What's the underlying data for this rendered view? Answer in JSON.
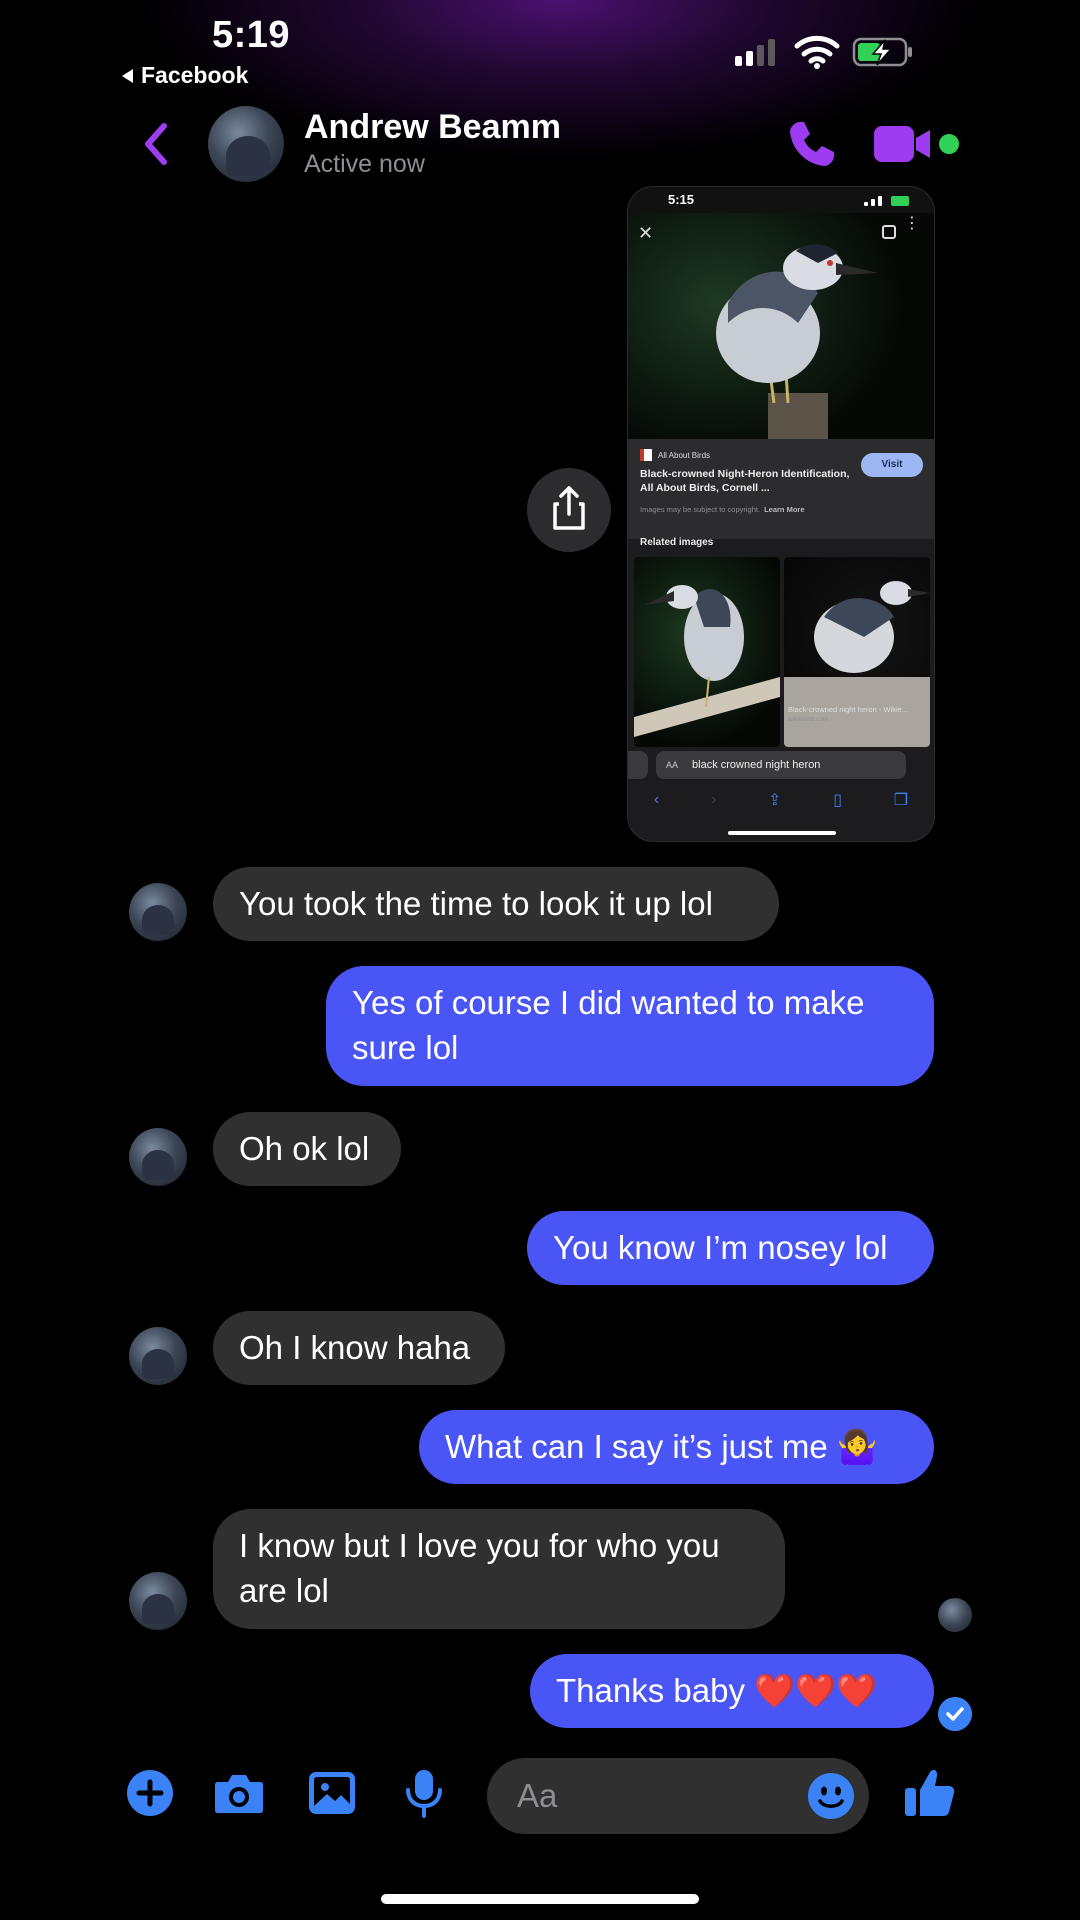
{
  "status_bar": {
    "time": "5:19",
    "back_app": "Facebook"
  },
  "header": {
    "contact_name": "Andrew Beamm",
    "status": "Active now"
  },
  "shared_screenshot": {
    "status_time": "5:15",
    "source_name": "All About Birds",
    "result_title": "Black-crowned Night-Heron Identification, All About Birds, Cornell ...",
    "visit_label": "Visit",
    "copyright_note": "Images may be subject to copyright.",
    "learn_more": "Learn More",
    "related_label": "Related images",
    "related_caption": "Black-crowned night heron - Wikie...",
    "related_source": "wikiwand.com",
    "url_aa": "AA",
    "url_text": "black crowned night heron"
  },
  "messages": [
    {
      "sender": "them",
      "text": "You took the time to look it up lol"
    },
    {
      "sender": "me",
      "text": "Yes of course I did wanted to make sure lol"
    },
    {
      "sender": "them",
      "text": "Oh ok lol"
    },
    {
      "sender": "me",
      "text": "You know I’m nosey lol"
    },
    {
      "sender": "them",
      "text": "Oh I know haha"
    },
    {
      "sender": "me",
      "text": "What can I say it’s just me 🤷‍♀️"
    },
    {
      "sender": "them",
      "text": "I know but I love you for who you are lol"
    },
    {
      "sender": "me",
      "text": "Thanks baby ❤️❤️❤️"
    }
  ],
  "composer": {
    "placeholder": "Aa"
  },
  "colors": {
    "accent_purple": "#9d3cf0",
    "accent_blue": "#3b82f6",
    "outgoing_bubble": "#4a55f5",
    "incoming_bubble": "#303030",
    "online": "#31d158"
  },
  "icons": [
    "back-chevron-icon",
    "phone-icon",
    "video-icon",
    "share-icon",
    "plus-icon",
    "camera-icon",
    "image-icon",
    "microphone-icon",
    "emoji-icon",
    "thumbs-up-icon",
    "check-icon"
  ]
}
